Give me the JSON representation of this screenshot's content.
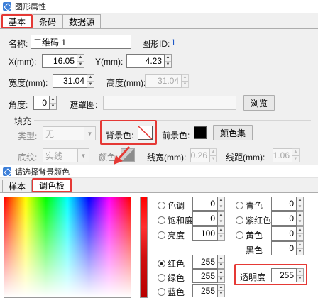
{
  "window": {
    "title": "图形属性"
  },
  "tabs": [
    {
      "label": "基本"
    },
    {
      "label": "条码"
    },
    {
      "label": "数据源"
    }
  ],
  "props": {
    "name_label": "名称:",
    "name_value": "二维码 1",
    "shape_id_label": "图形ID:",
    "shape_id_value": "1",
    "x_label": "X(mm):",
    "x_value": "16.05",
    "y_label": "Y(mm):",
    "y_value": "4.23",
    "width_label": "宽度(mm):",
    "width_value": "31.04",
    "height_label": "高度(mm):",
    "height_value": "31.04",
    "angle_label": "角度:",
    "angle_value": "0",
    "mask_label": "遮罩图:",
    "browse_button": "浏览"
  },
  "fill": {
    "group_label": "填充",
    "type_label": "类型:",
    "type_value": "无",
    "bg_color_label": "背景色:",
    "fg_color_label": "前景色:",
    "color_set_button": "颜色集",
    "fg_color": "#000000"
  },
  "border": {
    "style_label": "底纹:",
    "style_value": "实线",
    "color_label": "颜色:",
    "line_width_label": "线宽(mm):",
    "line_width_value": "0.26",
    "line_spacing_label": "线距(mm):",
    "line_spacing_value": "1.06"
  },
  "color_dialog": {
    "title": "请选择背景颜色",
    "tabs": [
      {
        "label": "样本"
      },
      {
        "label": "调色板"
      }
    ],
    "hue_label": "色调",
    "hue_value": "0",
    "saturation_label": "饱和度",
    "saturation_value": "0",
    "brightness_label": "亮度",
    "brightness_value": "100",
    "red_label": "红色",
    "red_value": "255",
    "green_label": "绿色",
    "green_value": "255",
    "blue_label": "蓝色",
    "blue_value": "255",
    "cyan_label": "青色",
    "cyan_value": "0",
    "magenta_label": "紫红色",
    "magenta_value": "0",
    "yellow_label": "黄色",
    "yellow_value": "0",
    "black_label": "黑色",
    "black_value": "0",
    "opacity_label": "透明度",
    "opacity_value": "255"
  },
  "colors": {
    "highlight": "#e53935",
    "accent_text": "#1a56c8"
  }
}
